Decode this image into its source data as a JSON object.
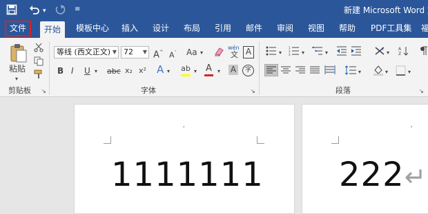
{
  "window": {
    "title": "新建 Microsoft Word 文",
    "quick_access": {
      "save_icon": "save-icon",
      "undo_icon": "undo-icon",
      "redo_icon": "redo-icon",
      "customize_icon": "customize-icon"
    }
  },
  "tabs": [
    {
      "label": "文件",
      "active": false,
      "highlighted": true
    },
    {
      "label": "开始",
      "active": true
    },
    {
      "label": "模板中心"
    },
    {
      "label": "插入"
    },
    {
      "label": "设计"
    },
    {
      "label": "布局"
    },
    {
      "label": "引用"
    },
    {
      "label": "邮件"
    },
    {
      "label": "审阅"
    },
    {
      "label": "视图"
    },
    {
      "label": "帮助"
    },
    {
      "label": "PDF工具集"
    },
    {
      "label": "福"
    }
  ],
  "ribbon": {
    "clipboard": {
      "paste_label": "粘贴",
      "group_label": "剪贴板"
    },
    "font": {
      "font_name": "等线 (西文正文)",
      "font_size": "72",
      "grow": "A",
      "shrink": "A",
      "case": "Aa",
      "phonetic": "wén",
      "phonetic_char": "文",
      "border_char": "A",
      "bold": "B",
      "italic": "I",
      "underline": "U",
      "strike": "abc",
      "subscript": "x₂",
      "superscript": "x²",
      "text_effect": "A",
      "highlight": "ab",
      "font_color": "A",
      "shading_char": "A",
      "enclose_char": "字",
      "group_label": "字体"
    },
    "paragraph": {
      "group_label": "段落"
    },
    "colors": {
      "accent": "#2b579a",
      "font_color_bar": "#e02020",
      "highlight_bar": "#ffff00"
    }
  },
  "document": {
    "page1_text": "1111111",
    "page2_text": "222",
    "paragraph_mark": "↵"
  }
}
